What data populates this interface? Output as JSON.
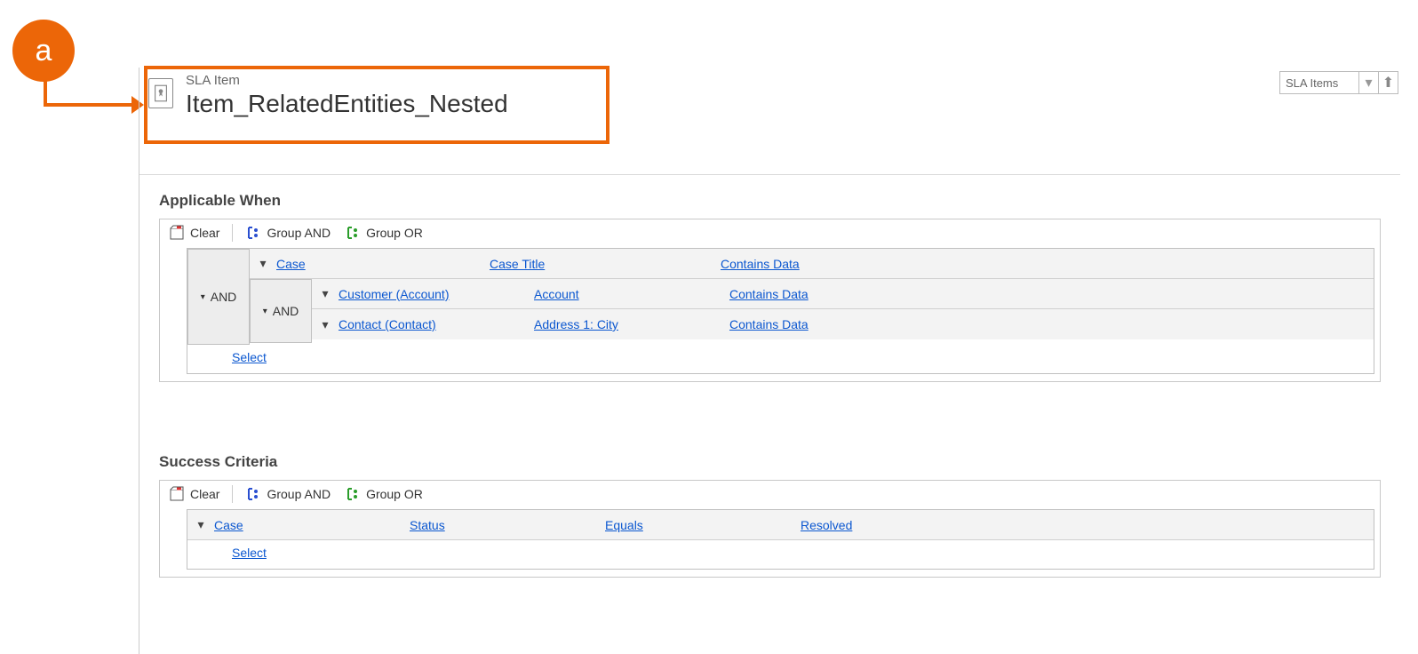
{
  "annotation": {
    "badge_letter": "a"
  },
  "header": {
    "entity_type": "SLA Item",
    "title": "Item_RelatedEntities_Nested"
  },
  "nav": {
    "related_label": "SLA Items"
  },
  "toolbar": {
    "clear": "Clear",
    "group_and": "Group AND",
    "group_or": "Group OR"
  },
  "common": {
    "and_label": "AND",
    "select_label": "Select"
  },
  "sections": {
    "applicable": {
      "heading": "Applicable When",
      "rows": {
        "r0": {
          "entity": "Case",
          "field": "Case Title",
          "op": "Contains Data"
        },
        "r1": {
          "entity": "Customer (Account)",
          "field": "Account",
          "op": "Contains Data"
        },
        "r2": {
          "entity": "Contact (Contact)",
          "field": "Address 1: City",
          "op": "Contains Data"
        }
      }
    },
    "success": {
      "heading": "Success Criteria",
      "rows": {
        "r0": {
          "entity": "Case",
          "field": "Status",
          "op": "Equals",
          "value": "Resolved"
        }
      }
    }
  }
}
